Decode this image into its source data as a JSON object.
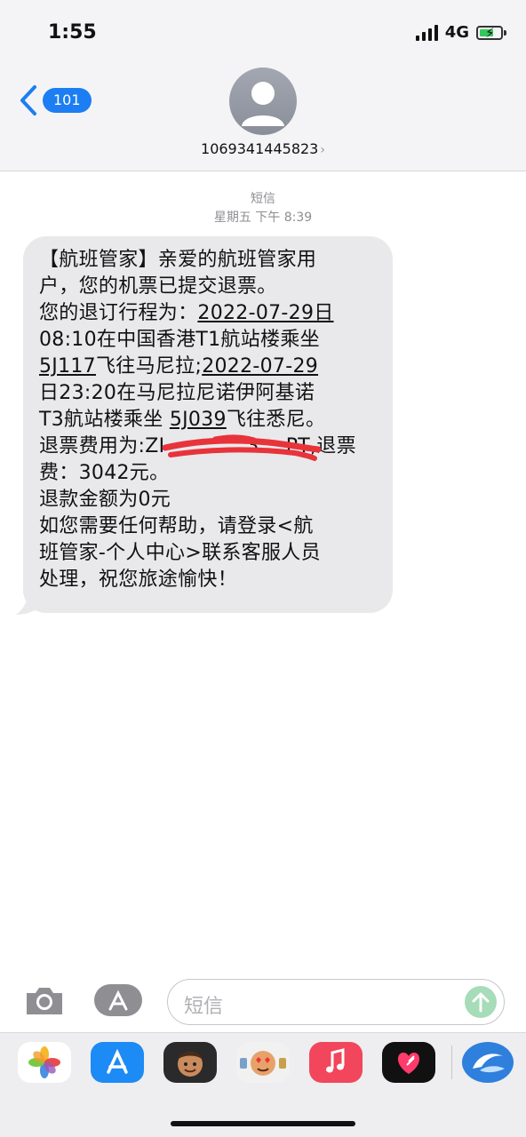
{
  "status_bar": {
    "time": "1:55",
    "network": "4G",
    "signal_bars": 4,
    "battery_charging": true
  },
  "header": {
    "back_badge": "101",
    "sender_number": "1069341445823",
    "sender_chevron": "›"
  },
  "conversation": {
    "service_label": "短信",
    "timestamp": "星期五 下午 8:39"
  },
  "message": {
    "lines": [
      "【航班管家】亲爱的航班管家用",
      "户，您的机票已提交退票。",
      "您的退订行程为：",
      "2022-07-29日",
      "08:10在中国香港T1航站楼乘坐",
      "5J117",
      "飞往马尼拉;",
      "2022-07-29",
      "日23:20在马尼拉尼诺伊阿基诺",
      "T3航站楼乘坐",
      "5J039",
      "飞往悉尼。",
      "退票费用为:ZI",
      "3",
      "PT,退票",
      "费：3042元。",
      "退款金额为0元",
      "如您需要任何帮助，请登录<航",
      "班管家-个人中心>联系客服人员",
      "处理，祝您旅途愉快！"
    ]
  },
  "input_bar": {
    "placeholder": "短信"
  },
  "app_drawer": {
    "apps": [
      {
        "name": "photos-app-icon",
        "color": "#ffffff"
      },
      {
        "name": "app-store-icon",
        "color": "#1c8bf5"
      },
      {
        "name": "memoji-icon",
        "color": "#2a2a2a"
      },
      {
        "name": "memoji-stickers-icon",
        "color": "#f1f1f1"
      },
      {
        "name": "music-app-icon",
        "color": "#f2465c"
      },
      {
        "name": "digital-touch-icon",
        "color": "#111111"
      },
      {
        "name": "flight-manager-app-icon",
        "color": "#2f7fdc"
      }
    ]
  },
  "colors": {
    "accent": "#1c7ef2",
    "bubble": "#e9e9eb",
    "send_button": "#a6dcb7",
    "scribble": "#e8333a"
  }
}
